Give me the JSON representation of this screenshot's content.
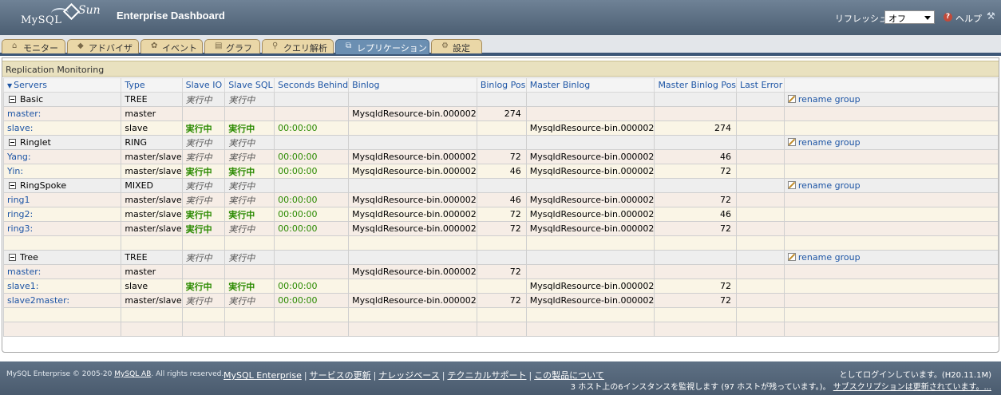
{
  "header": {
    "logo_text": "MySQL",
    "sun_text": "Sun",
    "title": "Enterprise Dashboard",
    "refresh_label": "リフレッシュ:",
    "refresh_value": "オフ",
    "help_label": "ヘルプ",
    "icons": {
      "help": "help-icon",
      "settings": "wrench-icon"
    }
  },
  "tabs": [
    {
      "label": "モニター",
      "icon": "home-icon"
    },
    {
      "label": "アドバイザ",
      "icon": "shield-icon"
    },
    {
      "label": "イベント",
      "icon": "event-icon"
    },
    {
      "label": "グラフ",
      "icon": "graph-icon"
    },
    {
      "label": "クエリ解析",
      "icon": "query-icon"
    },
    {
      "label": "レプリケーション",
      "icon": "replication-icon",
      "active": true
    },
    {
      "label": "設定",
      "icon": "gear-icon"
    }
  ],
  "panel": {
    "title": "Replication Monitoring",
    "columns": [
      "Servers",
      "Type",
      "Slave IO",
      "Slave SQL",
      "Seconds Behind",
      "Binlog",
      "Binlog Pos",
      "Master Binlog",
      "Master Binlog Pos",
      "Last Error"
    ],
    "rename_label": "rename group",
    "groups": [
      {
        "name": "Basic",
        "type": "TREE",
        "io": "実行中",
        "sql": "実行中",
        "rows": [
          {
            "server": "master:",
            "indent": 1,
            "type": "master",
            "io": "",
            "io_run": false,
            "sql": "",
            "sql_run": false,
            "sec": "",
            "binlog": "MysqldResource-bin.000002",
            "pos": "274",
            "mbinlog": "",
            "mpos": "",
            "err": ""
          },
          {
            "server": "slave:",
            "indent": 2,
            "type": "slave",
            "io": "実行中",
            "io_run": true,
            "sql": "実行中",
            "sql_run": true,
            "sec": "00:00:00",
            "binlog": "",
            "pos": "",
            "mbinlog": "MysqldResource-bin.000002",
            "mpos": "274",
            "err": ""
          }
        ]
      },
      {
        "name": "Ringlet",
        "type": "RING",
        "io": "実行中",
        "sql": "実行中",
        "rows": [
          {
            "server": "Yang:",
            "indent": 1,
            "type": "master/slave",
            "io": "実行中",
            "io_run": false,
            "sql": "実行中",
            "sql_run": false,
            "sec": "00:00:00",
            "binlog": "MysqldResource-bin.000002",
            "pos": "72",
            "mbinlog": "MysqldResource-bin.000002",
            "mpos": "46",
            "err": ""
          },
          {
            "server": "Yin:",
            "indent": 1,
            "type": "master/slave",
            "io": "実行中",
            "io_run": true,
            "sql": "実行中",
            "sql_run": true,
            "sec": "00:00:00",
            "binlog": "MysqldResource-bin.000002",
            "pos": "46",
            "mbinlog": "MysqldResource-bin.000002",
            "mpos": "72",
            "err": ""
          }
        ]
      },
      {
        "name": "RingSpoke",
        "type": "MIXED",
        "io": "実行中",
        "sql": "実行中",
        "rows": [
          {
            "server": "ring1",
            "indent": 1,
            "type": "master/slave",
            "io": "実行中",
            "io_run": false,
            "sql": "実行中",
            "sql_run": false,
            "sec": "00:00:00",
            "binlog": "MysqldResource-bin.000002",
            "pos": "46",
            "mbinlog": "MysqldResource-bin.000002",
            "mpos": "72",
            "err": ""
          },
          {
            "server": "ring2:",
            "indent": 1,
            "type": "master/slave",
            "io": "実行中",
            "io_run": true,
            "sql": "実行中",
            "sql_run": true,
            "sec": "00:00:00",
            "binlog": "MysqldResource-bin.000002",
            "pos": "72",
            "mbinlog": "MysqldResource-bin.000002",
            "mpos": "46",
            "err": ""
          },
          {
            "server": "ring3:",
            "indent": 1,
            "type": "master/slave",
            "io": "実行中",
            "io_run": true,
            "sql": "実行中",
            "sql_run": false,
            "sec": "00:00:00",
            "binlog": "MysqldResource-bin.000002",
            "pos": "72",
            "mbinlog": "MysqldResource-bin.000002",
            "mpos": "72",
            "err": ""
          },
          {
            "server": "",
            "indent": 1,
            "type": "",
            "io": "",
            "io_run": false,
            "sql": "",
            "sql_run": false,
            "sec": "",
            "binlog": "",
            "pos": "",
            "mbinlog": "",
            "mpos": "",
            "err": ""
          }
        ]
      },
      {
        "name": "Tree",
        "type": "TREE",
        "io": "実行中",
        "sql": "実行中",
        "rows": [
          {
            "server": "master:",
            "indent": 1,
            "type": "master",
            "io": "",
            "io_run": false,
            "sql": "",
            "sql_run": false,
            "sec": "",
            "binlog": "MysqldResource-bin.000002",
            "pos": "72",
            "mbinlog": "",
            "mpos": "",
            "err": ""
          },
          {
            "server": "slave1:",
            "indent": 2,
            "type": "slave",
            "io": "実行中",
            "io_run": true,
            "sql": "実行中",
            "sql_run": true,
            "sec": "00:00:00",
            "binlog": "",
            "pos": "",
            "mbinlog": "MysqldResource-bin.000002",
            "mpos": "72",
            "err": ""
          },
          {
            "server": "slave2master:",
            "indent": 2,
            "type": "master/slave",
            "io": "実行中",
            "io_run": false,
            "sql": "実行中",
            "sql_run": false,
            "sec": "00:00:00",
            "binlog": "MysqldResource-bin.000002",
            "pos": "72",
            "mbinlog": "MysqldResource-bin.000002",
            "mpos": "72",
            "err": ""
          }
        ]
      }
    ],
    "empty_rows": 2
  },
  "footer": {
    "copyright": "MySQL Enterprise © 2005-20",
    "copyright_link": "MySQL AB",
    "copyright_tail": ". All rights reserved.",
    "links": [
      "MySQL Enterprise",
      "サービスの更新",
      "ナレッジベース",
      "テクニカルサポート",
      "この製品について"
    ],
    "login": "としてログインしています。(H20.11.1",
    "login_tail": "M)",
    "status": "3 ホスト上の6インスタンスを監視します (97 ホストが残っています。)。",
    "subscription": "サブスクリプションは更新されています。..."
  }
}
